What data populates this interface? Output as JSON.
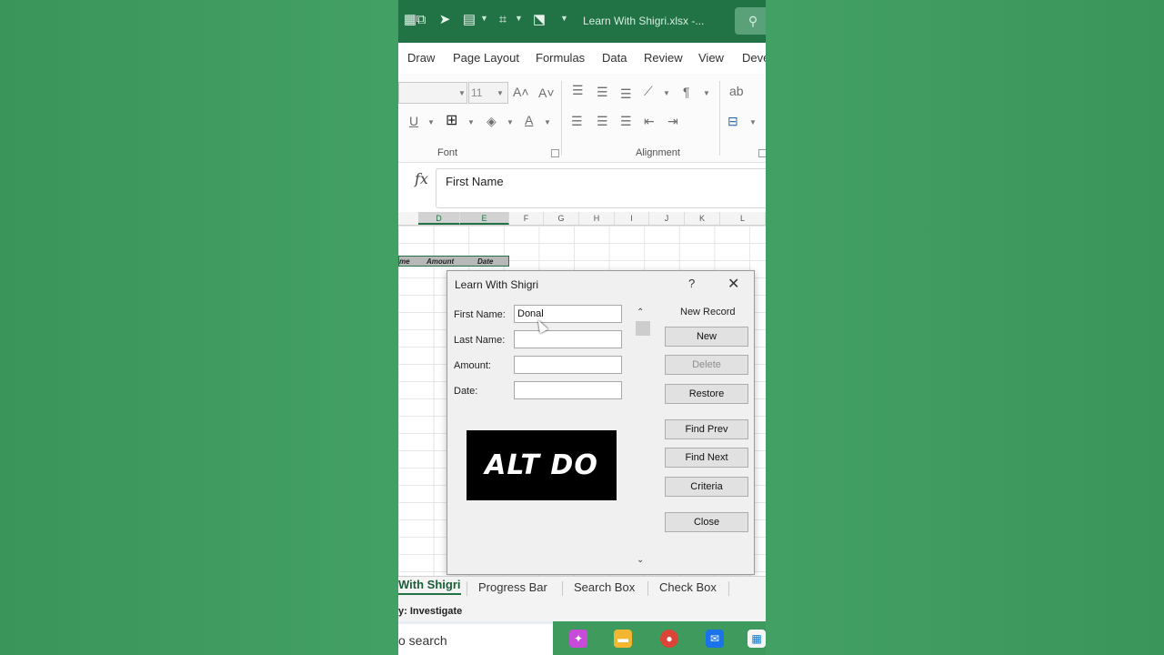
{
  "window": {
    "doc_title": "Learn With Shigri.xlsx  -..."
  },
  "ribbon_tabs": [
    "Draw",
    "Page Layout",
    "Formulas",
    "Data",
    "Review",
    "View",
    "Deve"
  ],
  "ribbon": {
    "font_size": "11",
    "font_group_label": "Font",
    "alignment_group_label": "Alignment"
  },
  "formula_bar": {
    "fx_label": "fx",
    "value": "First Name"
  },
  "columns": [
    "D",
    "E",
    "F",
    "G",
    "H",
    "I",
    "J",
    "K",
    "L"
  ],
  "table_headers": {
    "name": "me",
    "amount": "Amount",
    "date": "Date"
  },
  "dialog": {
    "title": "Learn With Shigri",
    "help": "?",
    "close": "✕",
    "record_label": "New Record",
    "fields": [
      {
        "label": "First Name:",
        "value": "Donal"
      },
      {
        "label": "Last Name:",
        "value": ""
      },
      {
        "label": "Amount:",
        "value": ""
      },
      {
        "label": "Date:",
        "value": ""
      }
    ],
    "buttons": {
      "new": "New",
      "delete": "Delete",
      "restore": "Restore",
      "find_prev": "Find Prev",
      "find_next": "Find Next",
      "criteria": "Criteria",
      "close": "Close"
    },
    "banner": "ALT DO"
  },
  "sheet_tabs": [
    "With Shigri",
    "Progress Bar",
    "Search Box",
    "Check Box"
  ],
  "status": {
    "text": "y: Investigate"
  },
  "taskbar": {
    "search_text": "o search"
  },
  "colors": {
    "excel_green": "#217346",
    "background_green": "#3d9a5e"
  }
}
